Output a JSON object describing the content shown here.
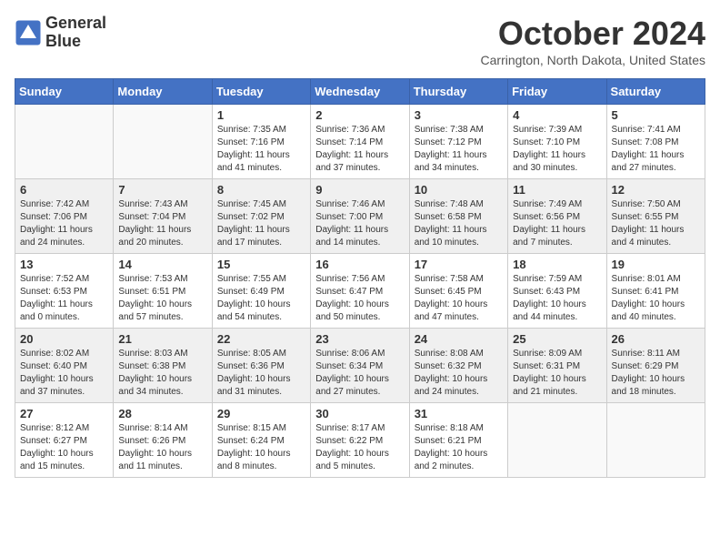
{
  "header": {
    "logo_line1": "General",
    "logo_line2": "Blue",
    "month": "October 2024",
    "location": "Carrington, North Dakota, United States"
  },
  "days_of_week": [
    "Sunday",
    "Monday",
    "Tuesday",
    "Wednesday",
    "Thursday",
    "Friday",
    "Saturday"
  ],
  "weeks": [
    [
      {
        "day": "",
        "info": ""
      },
      {
        "day": "",
        "info": ""
      },
      {
        "day": "1",
        "info": "Sunrise: 7:35 AM\nSunset: 7:16 PM\nDaylight: 11 hours and 41 minutes."
      },
      {
        "day": "2",
        "info": "Sunrise: 7:36 AM\nSunset: 7:14 PM\nDaylight: 11 hours and 37 minutes."
      },
      {
        "day": "3",
        "info": "Sunrise: 7:38 AM\nSunset: 7:12 PM\nDaylight: 11 hours and 34 minutes."
      },
      {
        "day": "4",
        "info": "Sunrise: 7:39 AM\nSunset: 7:10 PM\nDaylight: 11 hours and 30 minutes."
      },
      {
        "day": "5",
        "info": "Sunrise: 7:41 AM\nSunset: 7:08 PM\nDaylight: 11 hours and 27 minutes."
      }
    ],
    [
      {
        "day": "6",
        "info": "Sunrise: 7:42 AM\nSunset: 7:06 PM\nDaylight: 11 hours and 24 minutes."
      },
      {
        "day": "7",
        "info": "Sunrise: 7:43 AM\nSunset: 7:04 PM\nDaylight: 11 hours and 20 minutes."
      },
      {
        "day": "8",
        "info": "Sunrise: 7:45 AM\nSunset: 7:02 PM\nDaylight: 11 hours and 17 minutes."
      },
      {
        "day": "9",
        "info": "Sunrise: 7:46 AM\nSunset: 7:00 PM\nDaylight: 11 hours and 14 minutes."
      },
      {
        "day": "10",
        "info": "Sunrise: 7:48 AM\nSunset: 6:58 PM\nDaylight: 11 hours and 10 minutes."
      },
      {
        "day": "11",
        "info": "Sunrise: 7:49 AM\nSunset: 6:56 PM\nDaylight: 11 hours and 7 minutes."
      },
      {
        "day": "12",
        "info": "Sunrise: 7:50 AM\nSunset: 6:55 PM\nDaylight: 11 hours and 4 minutes."
      }
    ],
    [
      {
        "day": "13",
        "info": "Sunrise: 7:52 AM\nSunset: 6:53 PM\nDaylight: 11 hours and 0 minutes."
      },
      {
        "day": "14",
        "info": "Sunrise: 7:53 AM\nSunset: 6:51 PM\nDaylight: 10 hours and 57 minutes."
      },
      {
        "day": "15",
        "info": "Sunrise: 7:55 AM\nSunset: 6:49 PM\nDaylight: 10 hours and 54 minutes."
      },
      {
        "day": "16",
        "info": "Sunrise: 7:56 AM\nSunset: 6:47 PM\nDaylight: 10 hours and 50 minutes."
      },
      {
        "day": "17",
        "info": "Sunrise: 7:58 AM\nSunset: 6:45 PM\nDaylight: 10 hours and 47 minutes."
      },
      {
        "day": "18",
        "info": "Sunrise: 7:59 AM\nSunset: 6:43 PM\nDaylight: 10 hours and 44 minutes."
      },
      {
        "day": "19",
        "info": "Sunrise: 8:01 AM\nSunset: 6:41 PM\nDaylight: 10 hours and 40 minutes."
      }
    ],
    [
      {
        "day": "20",
        "info": "Sunrise: 8:02 AM\nSunset: 6:40 PM\nDaylight: 10 hours and 37 minutes."
      },
      {
        "day": "21",
        "info": "Sunrise: 8:03 AM\nSunset: 6:38 PM\nDaylight: 10 hours and 34 minutes."
      },
      {
        "day": "22",
        "info": "Sunrise: 8:05 AM\nSunset: 6:36 PM\nDaylight: 10 hours and 31 minutes."
      },
      {
        "day": "23",
        "info": "Sunrise: 8:06 AM\nSunset: 6:34 PM\nDaylight: 10 hours and 27 minutes."
      },
      {
        "day": "24",
        "info": "Sunrise: 8:08 AM\nSunset: 6:32 PM\nDaylight: 10 hours and 24 minutes."
      },
      {
        "day": "25",
        "info": "Sunrise: 8:09 AM\nSunset: 6:31 PM\nDaylight: 10 hours and 21 minutes."
      },
      {
        "day": "26",
        "info": "Sunrise: 8:11 AM\nSunset: 6:29 PM\nDaylight: 10 hours and 18 minutes."
      }
    ],
    [
      {
        "day": "27",
        "info": "Sunrise: 8:12 AM\nSunset: 6:27 PM\nDaylight: 10 hours and 15 minutes."
      },
      {
        "day": "28",
        "info": "Sunrise: 8:14 AM\nSunset: 6:26 PM\nDaylight: 10 hours and 11 minutes."
      },
      {
        "day": "29",
        "info": "Sunrise: 8:15 AM\nSunset: 6:24 PM\nDaylight: 10 hours and 8 minutes."
      },
      {
        "day": "30",
        "info": "Sunrise: 8:17 AM\nSunset: 6:22 PM\nDaylight: 10 hours and 5 minutes."
      },
      {
        "day": "31",
        "info": "Sunrise: 8:18 AM\nSunset: 6:21 PM\nDaylight: 10 hours and 2 minutes."
      },
      {
        "day": "",
        "info": ""
      },
      {
        "day": "",
        "info": ""
      }
    ]
  ]
}
